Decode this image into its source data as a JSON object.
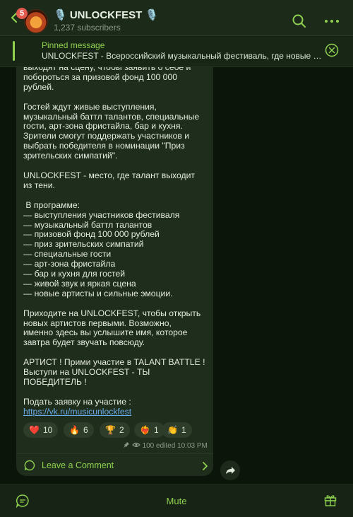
{
  "header": {
    "badge_count": "5",
    "title": "🎙️ UNLOCKFEST 🎙️",
    "subtitle": "1,237 subscribers",
    "icons": [
      "back-chevron-icon",
      "search-icon",
      "more-dots-icon"
    ]
  },
  "pinned": {
    "title": "Pinned message",
    "text": "UNLOCKFEST - Всероссийский музыкальный фестиваль, где новые а..."
  },
  "message": {
    "text": "выходят на сцену, чтобы заявить о себе и\nпобороться за призовой фонд 100 000\nрублей.\n\nГостей ждут живые выступления,\nмузыкальный баттл талантов, специальные\nгости, арт-зона фристайла, бар и кухня.\nЗрители смогут поддержать участников и\nвыбрать победителя в номинации \"Приз\nзрительских симпатий\".\n\nUNLOCKFEST - место, где талант выходит\nиз тени.\n\n В программе:\n— выступления участников фестиваля\n— музыкальный баттл талантов\n— призовой фонд 100 000 рублей\n— приз зрительских симпатий\n— специальные гости\n— арт-зона фристайла\n— бар и кухня для гостей\n— живой звук и яркая сцена\n— новые артисты и сильные эмоции.\n\nПриходите на UNLOCKFEST, чтобы открыть\nновых артистов первыми. Возможно,\nименно здесь вы услышите имя, которое\nзавтра будет звучать повсюду.\n\nАРТИСТ ! Прими участие в TALANT BATTLE !\nВыступи на UNLOCKFEST - ТЫ\nПОБЕДИТЕЛЬ !\n\nПодать заявку на участие :\n",
    "link": "https://vk.ru/musicunlockfest",
    "reactions": [
      {
        "emoji": "❤️",
        "count": "10"
      },
      {
        "emoji": "🔥",
        "count": "6"
      },
      {
        "emoji": "🏆",
        "count": "2"
      },
      {
        "emoji": "❤️‍🔥",
        "count": "1"
      },
      {
        "emoji": "👏",
        "count": "1"
      }
    ],
    "views": "100",
    "meta": "edited 10:03 PM",
    "comment_label": "Leave a Comment"
  },
  "bottom": {
    "mute_label": "Mute"
  },
  "colors": {
    "accent": "#8fd14f",
    "link": "#6aabe8",
    "badge": "#e25a4e"
  }
}
